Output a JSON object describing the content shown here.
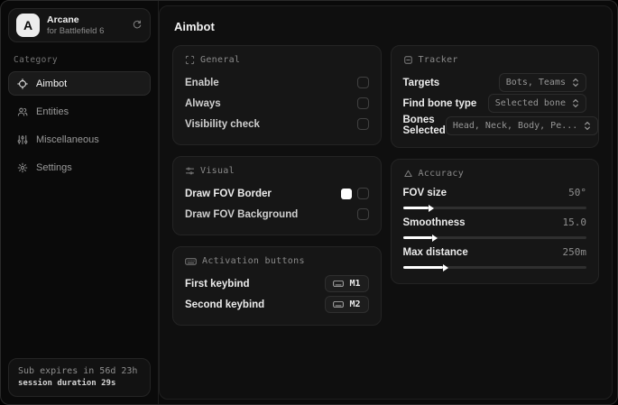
{
  "colors": {
    "window_bg": "#0a0a0a",
    "panel_bg": "#0f0f0f",
    "card_bg": "#161616",
    "border": "#2a2a2a",
    "text_primary": "#f2f2f2",
    "text_muted": "#8c8c8c",
    "accent": "#ffffff",
    "fov_border_swatch": "#ffffff"
  },
  "sidebar": {
    "brand": {
      "logo_letter": "A",
      "name": "Arcane",
      "subtitle": "for Battlefield 6",
      "action_icon": "refresh-icon"
    },
    "category_label": "Category",
    "items": [
      {
        "label": "Aimbot",
        "icon": "crosshair-icon",
        "active": true
      },
      {
        "label": "Entities",
        "icon": "users-icon",
        "active": false
      },
      {
        "label": "Miscellaneous",
        "icon": "sliders-icon",
        "active": false
      },
      {
        "label": "Settings",
        "icon": "gear-icon",
        "active": false
      }
    ],
    "footer": {
      "line1": "Sub expires in 56d 23h",
      "line2": "session duration 29s"
    }
  },
  "main": {
    "title": "Aimbot",
    "general": {
      "header": "General",
      "icon": "scan-frame-icon",
      "rows": [
        {
          "label": "Enable",
          "checked": false
        },
        {
          "label": "Always",
          "checked": false
        },
        {
          "label": "Visibility check",
          "checked": false
        }
      ]
    },
    "visual": {
      "header": "Visual",
      "icon": "sliders-horizontal-icon",
      "rows": [
        {
          "label": "Draw FOV Border",
          "has_swatch": true,
          "swatch_color": "#ffffff",
          "checked": false
        },
        {
          "label": "Draw FOV Background",
          "has_swatch": false,
          "checked": false
        }
      ]
    },
    "activation": {
      "header": "Activation buttons",
      "icon": "keyboard-icon",
      "rows": [
        {
          "label": "First keybind",
          "key": "M1"
        },
        {
          "label": "Second keybind",
          "key": "M2"
        }
      ]
    },
    "tracker": {
      "header": "Tracker",
      "icon": "square-minus-icon",
      "rows": [
        {
          "label": "Targets",
          "value": "Bots, Teams"
        },
        {
          "label": "Find bone type",
          "value": "Selected bone"
        },
        {
          "label": "Bones Selected",
          "value": "Head, Neck, Body, Pe..."
        }
      ]
    },
    "accuracy": {
      "header": "Accuracy",
      "icon": "triangle-icon",
      "sliders": [
        {
          "label": "FOV size",
          "value": "50°",
          "percent": 14,
          "fill_style": "width:14%"
        },
        {
          "label": "Smoothness",
          "value": "15.0",
          "percent": 16,
          "fill_style": "width:16%"
        },
        {
          "label": "Max distance",
          "value": "250m",
          "percent": 22,
          "fill_style": "width:22%"
        }
      ]
    }
  }
}
